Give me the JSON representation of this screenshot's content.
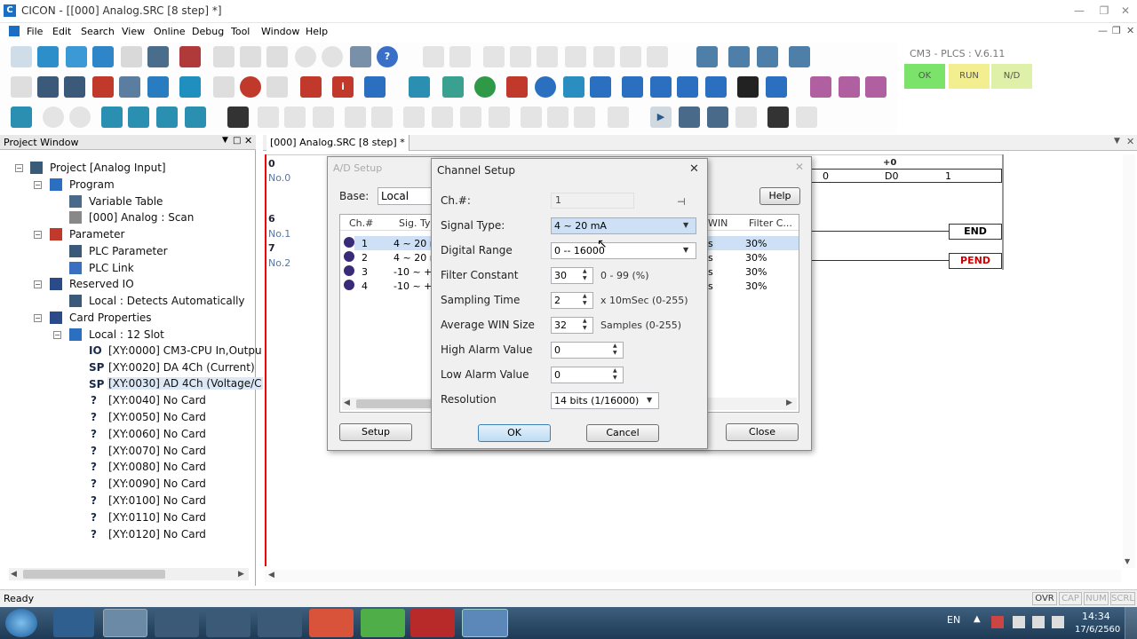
{
  "window": {
    "title": "CICON - [[000] Analog.SRC [8 step] *]",
    "app_icon": "C"
  },
  "menu": [
    "File",
    "Edit",
    "Search",
    "View",
    "Online",
    "Debug",
    "Tool",
    "Window",
    "Help"
  ],
  "plc_status": {
    "model": "CM3 - PLCS : V.6.11",
    "lamps": [
      "OK",
      "RUN",
      "N/D"
    ]
  },
  "project": {
    "header": "Project Window",
    "items": [
      {
        "label": "Project [Analog Input]"
      },
      {
        "label": "Program"
      },
      {
        "label": "Variable Table"
      },
      {
        "label": "[000] Analog : Scan"
      },
      {
        "label": "Parameter"
      },
      {
        "label": "PLC Parameter"
      },
      {
        "label": "PLC Link"
      },
      {
        "label": "Reserved IO"
      },
      {
        "label": "Local : Detects Automatically"
      },
      {
        "label": "Card Properties"
      },
      {
        "label": "Local : 12 Slot"
      },
      {
        "label": "[XY:0000] CM3-CPU In,Outpu"
      },
      {
        "label": "[XY:0020] DA 4Ch (Current)"
      },
      {
        "label": "[XY:0030] AD 4Ch (Voltage/C"
      },
      {
        "label": "[XY:0040] No Card"
      },
      {
        "label": "[XY:0050] No Card"
      },
      {
        "label": "[XY:0060] No Card"
      },
      {
        "label": "[XY:0070] No Card"
      },
      {
        "label": "[XY:0080] No Card"
      },
      {
        "label": "[XY:0090] No Card"
      },
      {
        "label": "[XY:0100] No Card"
      },
      {
        "label": "[XY:0110] No Card"
      },
      {
        "label": "[XY:0120] No Card"
      }
    ]
  },
  "editor": {
    "tab": "[000] Analog.SRC [8 step] *",
    "rungs": [
      {
        "num": "0",
        "label": "No.0"
      },
      {
        "num": "6",
        "label": "No.1"
      },
      {
        "num": "7",
        "label": "No.2"
      }
    ],
    "ladder": {
      "offset": "+0",
      "c1": "0",
      "c2": "D0",
      "c3": "1",
      "end": "END",
      "pend": "PEND"
    }
  },
  "ad_setup": {
    "title": "A/D Setup",
    "base_label": "Base:",
    "base_value": "Local",
    "help": "Help",
    "columns": [
      "Ch.#",
      "Sig. Ty",
      "WIN",
      "Filter C..."
    ],
    "rows": [
      {
        "ch": "1",
        "sig": "4 ~ 20 m",
        "win": "s",
        "filter": "30%"
      },
      {
        "ch": "2",
        "sig": "4 ~ 20 m",
        "win": "s",
        "filter": "30%"
      },
      {
        "ch": "3",
        "sig": "-10 ~ +1",
        "win": "s",
        "filter": "30%"
      },
      {
        "ch": "4",
        "sig": "-10 ~ +1",
        "win": "s",
        "filter": "30%"
      }
    ],
    "setup": "Setup",
    "close": "Close"
  },
  "channel_setup": {
    "title": "Channel Setup",
    "ch_label": "Ch.#:",
    "ch_value": "1",
    "signal_label": "Signal Type:",
    "signal_value": "4 ~ 20 mA",
    "range_label": "Digital Range",
    "range_value": "0 -- 16000",
    "filter_label": "Filter Constant",
    "filter_value": "30",
    "filter_unit": "0 - 99 (%)",
    "sampling_label": "Sampling Time",
    "sampling_value": "2",
    "sampling_unit": "x 10mSec (0-255)",
    "avg_label": "Average WIN Size",
    "avg_value": "32",
    "avg_unit": "Samples (0-255)",
    "high_label": "High Alarm Value",
    "high_value": "0",
    "low_label": "Low Alarm Value",
    "low_value": "0",
    "res_label": "Resolution",
    "res_value": "14 bits (1/16000)",
    "ok": "OK",
    "cancel": "Cancel"
  },
  "statusbar": {
    "left": "Ready",
    "indicators": [
      "OVR",
      "CAP",
      "NUM",
      "SCRL"
    ]
  },
  "taskbar": {
    "lang": "EN",
    "time": "14:34",
    "date": "17/6/2560"
  }
}
